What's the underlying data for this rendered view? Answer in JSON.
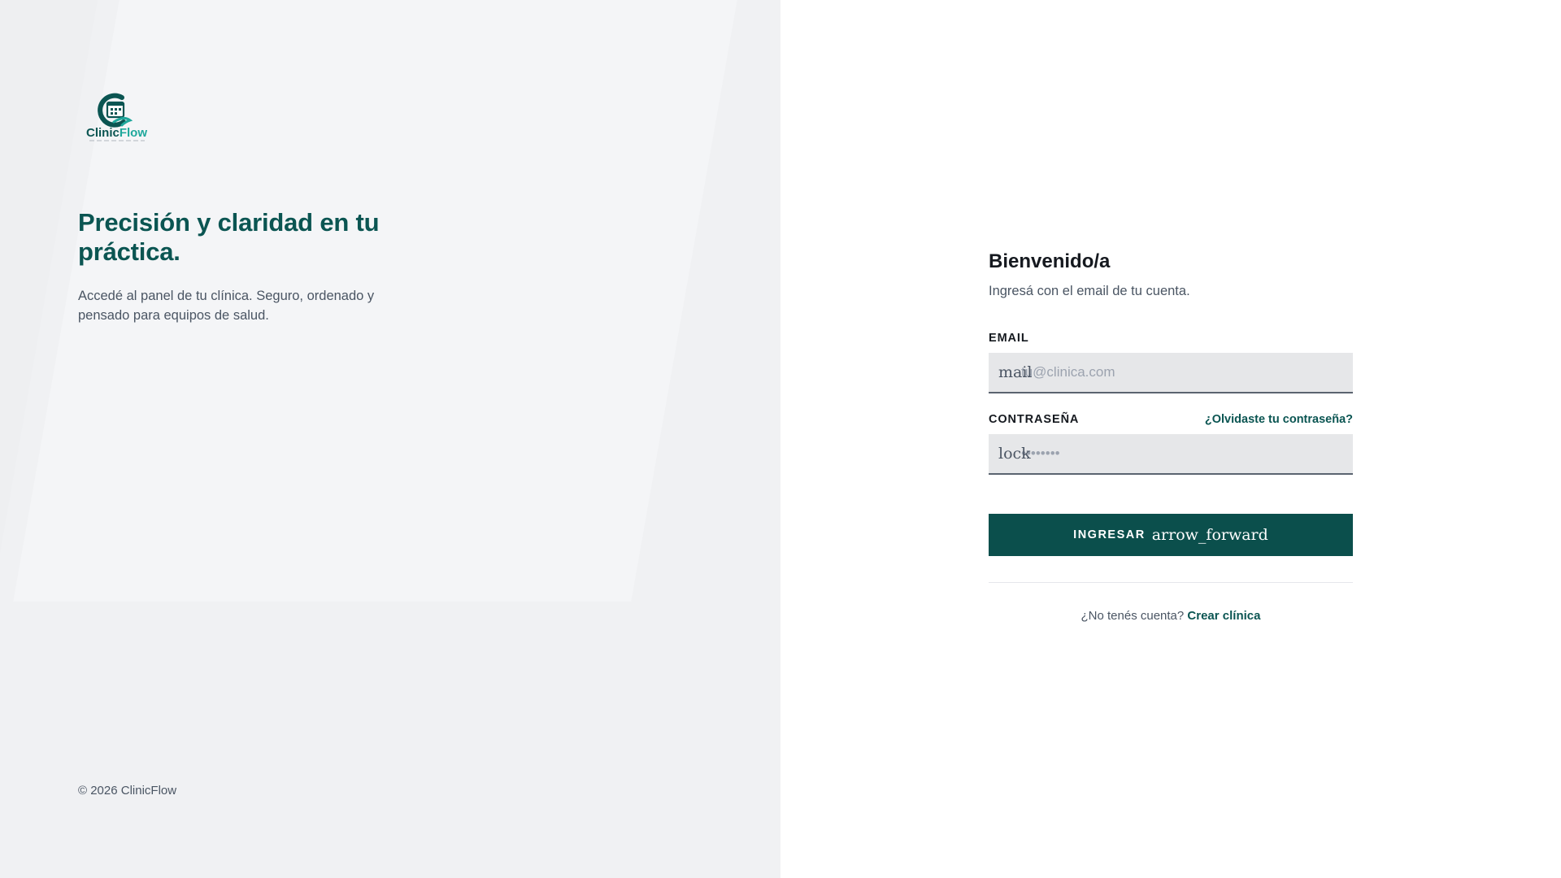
{
  "brand": {
    "name": "ClinicFlow",
    "name_part1": "Clinic",
    "name_part2": "Flow",
    "primary_color": "#0b5552",
    "button_color": "#0b4f4c",
    "accent_color": "#1fa89c"
  },
  "hero": {
    "title": "Precisión y claridad en tu práctica.",
    "subtitle": "Accedé al panel de tu clínica. Seguro, ordenado y pensado para equipos de salud."
  },
  "footer": {
    "copyright": "© 2026 ClinicFlow"
  },
  "login": {
    "title": "Bienvenido/a",
    "subtitle": "Ingresá con el email de tu cuenta.",
    "email_label": "EMAIL",
    "email_icon": "mail",
    "email_placeholder": "tu@clinica.com",
    "email_value": "",
    "password_label": "CONTRASEÑA",
    "password_icon": "lock",
    "password_placeholder": "••••••••",
    "password_value": "",
    "forgot_link": "¿Olvidaste tu contraseña?",
    "submit_label": "INGRESAR",
    "submit_icon": "arrow_forward",
    "no_account_text": "¿No tenés cuenta?",
    "create_link": "Crear clínica"
  }
}
